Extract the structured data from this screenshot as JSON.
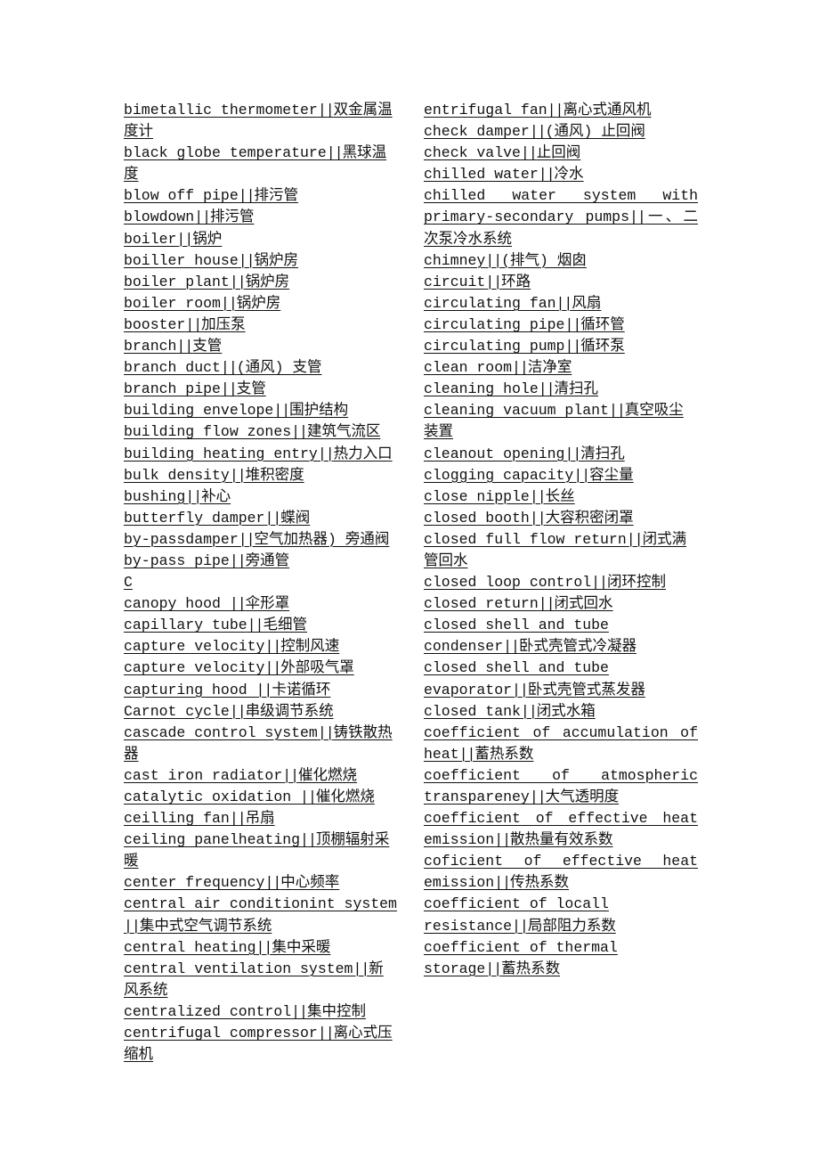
{
  "document": {
    "left_column": [
      {
        "term": "bimetallic thermometer",
        "translation": "双金属温度计"
      },
      {
        "term": "black globe temperature",
        "translation": "黑球温度"
      },
      {
        "term": "blow off pipe",
        "translation": "排污管"
      },
      {
        "term": "blowdown",
        "translation": "排污管"
      },
      {
        "term": "boiler",
        "translation": "锅炉"
      },
      {
        "term": "boiller house",
        "translation": "锅炉房"
      },
      {
        "term": "boiler plant",
        "translation": "锅炉房"
      },
      {
        "term": "boiler room",
        "translation": "锅炉房"
      },
      {
        "term": "booster",
        "translation": "加压泵"
      },
      {
        "term": "branch",
        "translation": "支管"
      },
      {
        "term": "branch duct",
        "translation": "(通风) 支管"
      },
      {
        "term": "branch pipe",
        "translation": "支管"
      },
      {
        "term": "building envelope",
        "translation": "围护结构"
      },
      {
        "term": "building flow zones",
        "translation": "建筑气流区"
      },
      {
        "term": "building heating entry",
        "translation": "热力入口"
      },
      {
        "term": "bulk density",
        "translation": "堆积密度"
      },
      {
        "term": "bushing",
        "translation": "补心"
      },
      {
        "term": "butterfly damper",
        "translation": "蝶阀"
      },
      {
        "term": "by-passdamper",
        "translation": "空气加热器) 旁通阀"
      },
      {
        "term": "by-pass pipe",
        "translation": "旁通管"
      },
      {
        "heading": "C"
      },
      {
        "term": "canopy hood ",
        "translation": "伞形罩"
      },
      {
        "term": "capillary tube",
        "translation": "毛细管"
      },
      {
        "term": "capture velocity",
        "translation": "控制风速"
      },
      {
        "term": "capture velocity",
        "translation": "外部吸气罩"
      },
      {
        "term": "capturing hood ",
        "translation": "卡诺循环"
      },
      {
        "term": "Carnot cycle",
        "translation": "串级调节系统"
      },
      {
        "term": "cascade control system",
        "translation": "铸铁散热器"
      },
      {
        "term": "cast iron radiator",
        "translation": "催化燃烧"
      },
      {
        "term": "catalytic oxidation ",
        "translation": "催化燃烧"
      },
      {
        "term": "ceilling fan",
        "translation": "吊扇"
      },
      {
        "term": "ceiling panelheating",
        "translation": "顶棚辐射采暖"
      },
      {
        "term": "center frequency",
        "translation": "中心频率"
      },
      {
        "term": "central air conditionint system ",
        "translation": "集中式空气调节系统"
      },
      {
        "term": "central heating",
        "translation": "集中采暖"
      },
      {
        "term": "central ventilation system",
        "translation": "新风系统"
      },
      {
        "term": "centralized control",
        "translation": "集中控制"
      },
      {
        "term": "centrifugal compressor",
        "translation": "离心式压缩机"
      }
    ],
    "right_column": [
      {
        "term": "entrifugal fan",
        "translation": "离心式通风机"
      },
      {
        "term": "check damper",
        "translation": "(通风) 止回阀"
      },
      {
        "term": "check valve",
        "translation": "止回阀"
      },
      {
        "term": "chilled water",
        "translation": "冷水"
      },
      {
        "term": "chilled water system with primary-secondary pumps",
        "translation": "一、二次泵冷水系统",
        "justify": true
      },
      {
        "term": "chimney",
        "translation": "(排气) 烟囱"
      },
      {
        "term": "circuit",
        "translation": "环路"
      },
      {
        "term": "circulating fan",
        "translation": "风扇"
      },
      {
        "term": "circulating pipe",
        "translation": "循环管"
      },
      {
        "term": "circulating pump",
        "translation": "循环泵"
      },
      {
        "term": "clean room",
        "translation": "洁净室"
      },
      {
        "term": "cleaning hole",
        "translation": "清扫孔"
      },
      {
        "term": "cleaning vacuum plant",
        "translation": "真空吸尘装置"
      },
      {
        "term": "cleanout opening",
        "translation": "清扫孔"
      },
      {
        "term": "clogging capacity",
        "translation": "容尘量"
      },
      {
        "term": "close nipple",
        "translation": "长丝"
      },
      {
        "term": "closed booth",
        "translation": "大容积密闭罩"
      },
      {
        "term": "closed full flow return",
        "translation": "闭式满管回水"
      },
      {
        "term": "closed loop control",
        "translation": "闭环控制"
      },
      {
        "term": "closed return",
        "translation": "闭式回水"
      },
      {
        "term": "closed shell and tube condenser",
        "translation": "卧式壳管式冷凝器"
      },
      {
        "term": "closed shell and tube evaporator",
        "translation": "卧式壳管式蒸发器"
      },
      {
        "term": "closed tank",
        "translation": "闭式水箱"
      },
      {
        "term": "coefficient of accumulation of heat",
        "translation": "蓄热系数",
        "justify": true
      },
      {
        "term": "coefficient of atmospheric transpareney",
        "translation": "大气透明度",
        "justify": true
      },
      {
        "term": "coefficient of effective heat emission",
        "translation": "散热量有效系数",
        "justify": true
      },
      {
        "term": "coficient of effective heat emission",
        "translation": "传热系数",
        "justify": true
      },
      {
        "term": "coefficient of locall resistance",
        "translation": "局部阻力系数"
      },
      {
        "term": "coefficient of thermal storage",
        "translation": "蓄热系数"
      }
    ],
    "separator": "||"
  }
}
